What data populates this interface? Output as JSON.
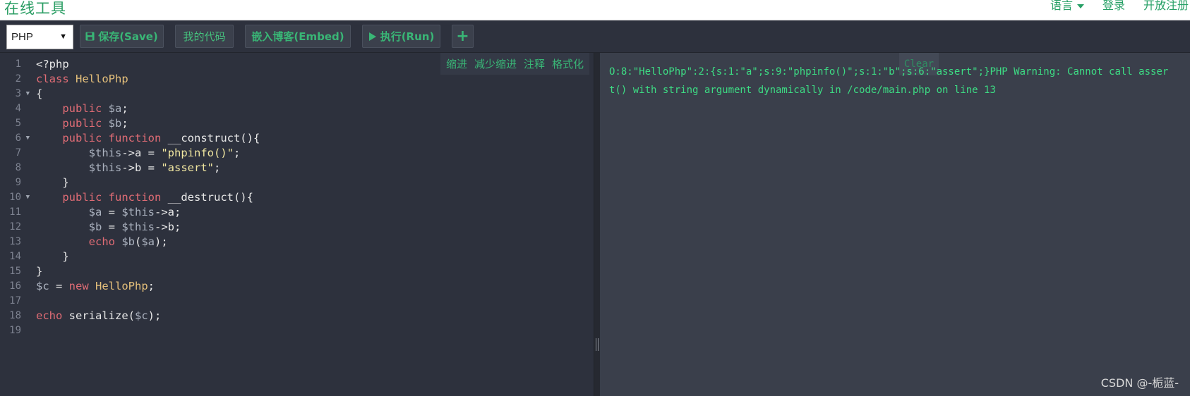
{
  "nav": {
    "brand": "在线工具",
    "language": "语言",
    "login": "登录",
    "register": "开放注册"
  },
  "toolbar": {
    "language_value": "PHP",
    "save": "保存(Save)",
    "my_code": "我的代码",
    "embed": "嵌入博客(Embed)",
    "run": "执行(Run)",
    "add": "+"
  },
  "editor": {
    "tools": [
      "缩进",
      "减少缩进",
      "注释",
      "格式化"
    ],
    "lines": [
      "1",
      "2",
      "3",
      "4",
      "5",
      "6",
      "7",
      "8",
      "9",
      "10",
      "11",
      "12",
      "13",
      "14",
      "15",
      "16",
      "17",
      "18",
      "19"
    ]
  },
  "output": {
    "clear": "Clear",
    "text": "O:8:\"HelloPhp\":2:{s:1:\"a\";s:9:\"phpinfo()\";s:1:\"b\";s:6:\"assert\";}PHP Warning:  Cannot call assert() with string argument dynamically in /code/main.php on line 13"
  },
  "watermark": "CSDN @-栀蓝-",
  "colors": {
    "accent": "#39b676",
    "editor_bg": "#2d313d",
    "output_bg": "#3a3f4b",
    "output_text": "#3ddc84"
  }
}
